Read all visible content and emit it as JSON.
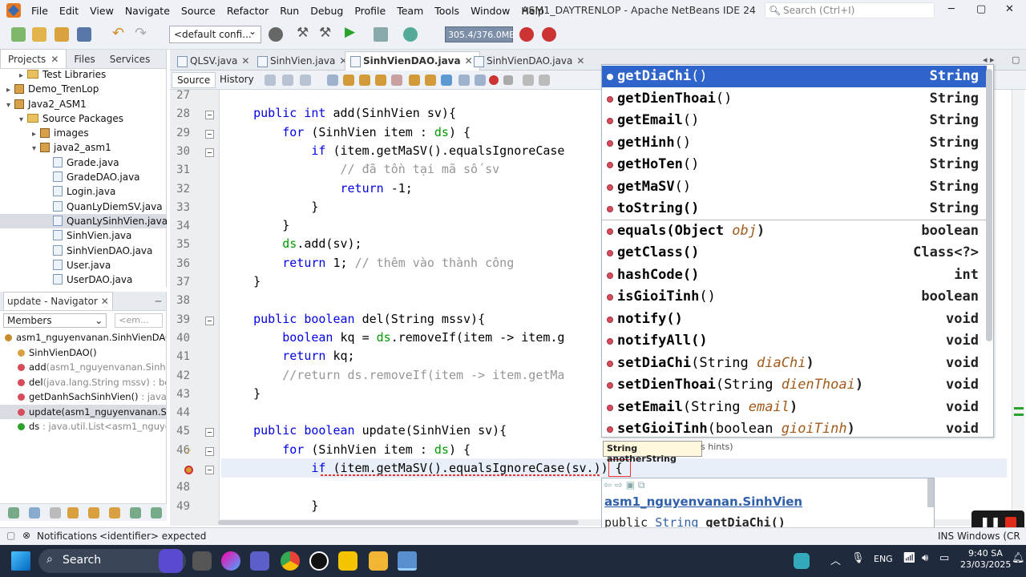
{
  "window": {
    "title": "ASM1_DAYTRENLOP - Apache NetBeans IDE 24",
    "search_placeholder": "Search (Ctrl+I)"
  },
  "menu": [
    "File",
    "Edit",
    "View",
    "Navigate",
    "Source",
    "Refactor",
    "Run",
    "Debug",
    "Profile",
    "Team",
    "Tools",
    "Window",
    "Help"
  ],
  "toolbar": {
    "config": "<default confi...",
    "memory": "305.4/376.0MB"
  },
  "projects_pane": {
    "tabs": [
      "Projects",
      "Files",
      "Services"
    ],
    "items": [
      {
        "label": "Test Libraries",
        "kind": "folder",
        "indent": 1,
        "arrow": "▸"
      },
      {
        "label": "Demo_TrenLop",
        "kind": "project",
        "indent": 0,
        "arrow": "▸"
      },
      {
        "label": "Java2_ASM1",
        "kind": "project",
        "indent": 0,
        "arrow": "▾"
      },
      {
        "label": "Source Packages",
        "kind": "folder",
        "indent": 1,
        "arrow": "▾"
      },
      {
        "label": "images",
        "kind": "package",
        "indent": 2,
        "arrow": "▸"
      },
      {
        "label": "java2_asm1",
        "kind": "package",
        "indent": 2,
        "arrow": "▾"
      },
      {
        "label": "Grade.java",
        "kind": "file",
        "indent": 3,
        "arrow": ""
      },
      {
        "label": "GradeDAO.java",
        "kind": "file",
        "indent": 3,
        "arrow": ""
      },
      {
        "label": "Login.java",
        "kind": "file",
        "indent": 3,
        "arrow": ""
      },
      {
        "label": "QuanLyDiemSV.java",
        "kind": "file",
        "indent": 3,
        "arrow": ""
      },
      {
        "label": "QuanLySinhVien.java",
        "kind": "file",
        "indent": 3,
        "arrow": "",
        "selected": true
      },
      {
        "label": "SinhVien.java",
        "kind": "file",
        "indent": 3,
        "arrow": ""
      },
      {
        "label": "SinhVienDAO.java",
        "kind": "file",
        "indent": 3,
        "arrow": ""
      },
      {
        "label": "User.java",
        "kind": "file",
        "indent": 3,
        "arrow": ""
      },
      {
        "label": "UserDAO.java",
        "kind": "file",
        "indent": 3,
        "arrow": ""
      }
    ]
  },
  "navigator": {
    "title": "update - Navigator",
    "filter": "Members",
    "filter2": "<em...",
    "items": [
      {
        "main": "asm1_nguyenvanan.SinhVienDAO",
        "gray": " :",
        "icon": "class",
        "indent": 0
      },
      {
        "main": "SinhVienDAO()",
        "gray": "",
        "icon": "ctor",
        "indent": 1
      },
      {
        "main": "add",
        "gray": "(asm1_nguyenvanan.SinhVie",
        "icon": "method",
        "indent": 1
      },
      {
        "main": "del",
        "gray": "(java.lang.String mssv) : bool",
        "icon": "method",
        "indent": 1
      },
      {
        "main": "getDanhSachSinhVien()",
        "gray": " : java.uti",
        "icon": "method",
        "indent": 1
      },
      {
        "main": "update(asm1_nguyenvanan.Sinh",
        "gray": "",
        "icon": "method",
        "indent": 1,
        "selected": true
      },
      {
        "main": "ds",
        "gray": " : java.util.List<asm1_nguyenv",
        "icon": "field",
        "indent": 1
      }
    ]
  },
  "editor": {
    "tabs": [
      {
        "label": "QLSV.java"
      },
      {
        "label": "SinhVien.java"
      },
      {
        "label": "SinhVienDAO.java",
        "active": true
      },
      {
        "label": "SinhVienDAO.java"
      }
    ],
    "subtabs": [
      "Source",
      "History"
    ],
    "lines": [
      {
        "n": "27",
        "t": []
      },
      {
        "n": "28",
        "fold": true,
        "t": [
          [
            "    "
          ],
          [
            "public",
            "kw"
          ],
          [
            " "
          ],
          [
            "int",
            "kw"
          ],
          [
            " add(SinhVien sv){"
          ]
        ]
      },
      {
        "n": "29",
        "fold": true,
        "t": [
          [
            "        "
          ],
          [
            "for",
            "kw"
          ],
          [
            " (SinhVien item : "
          ],
          [
            "ds",
            "fld"
          ],
          [
            ") {"
          ]
        ]
      },
      {
        "n": "30",
        "fold": true,
        "t": [
          [
            "            "
          ],
          [
            "if",
            "kw"
          ],
          [
            " (item.getMaSV().equalsIgnoreCase"
          ]
        ]
      },
      {
        "n": "31",
        "t": [
          [
            "                "
          ],
          [
            "// đã tồn tại mã số sv",
            "cm"
          ]
        ]
      },
      {
        "n": "32",
        "t": [
          [
            "                "
          ],
          [
            "return",
            "kw"
          ],
          [
            " -1;"
          ]
        ]
      },
      {
        "n": "33",
        "t": [
          [
            "            }"
          ]
        ]
      },
      {
        "n": "34",
        "t": [
          [
            "        }"
          ]
        ]
      },
      {
        "n": "35",
        "t": [
          [
            "        "
          ],
          [
            "ds",
            "fld"
          ],
          [
            ".add(sv);"
          ]
        ]
      },
      {
        "n": "36",
        "t": [
          [
            "        "
          ],
          [
            "return",
            "kw"
          ],
          [
            " 1; "
          ],
          [
            "// thêm vào thành công",
            "cm"
          ]
        ]
      },
      {
        "n": "37",
        "t": [
          [
            "    }"
          ]
        ]
      },
      {
        "n": "38",
        "t": []
      },
      {
        "n": "39",
        "fold": true,
        "t": [
          [
            "    "
          ],
          [
            "public",
            "kw"
          ],
          [
            " "
          ],
          [
            "boolean",
            "kw"
          ],
          [
            " del(String mssv){"
          ]
        ]
      },
      {
        "n": "40",
        "t": [
          [
            "        "
          ],
          [
            "boolean",
            "kw"
          ],
          [
            " kq = "
          ],
          [
            "ds",
            "fld"
          ],
          [
            ".removeIf(item -> item.g"
          ]
        ]
      },
      {
        "n": "41",
        "t": [
          [
            "        "
          ],
          [
            "return",
            "kw"
          ],
          [
            " kq;"
          ]
        ]
      },
      {
        "n": "42",
        "t": [
          [
            "        "
          ],
          [
            "//return ds.removeIf(item -> item.getMa",
            "cm"
          ]
        ]
      },
      {
        "n": "43",
        "t": [
          [
            "    }"
          ]
        ]
      },
      {
        "n": "44",
        "t": []
      },
      {
        "n": "45",
        "fold": true,
        "t": [
          [
            "    "
          ],
          [
            "public",
            "kw"
          ],
          [
            " "
          ],
          [
            "boolean",
            "kw"
          ],
          [
            " update(SinhVien sv){"
          ]
        ]
      },
      {
        "n": "46",
        "fold": true,
        "bulb": true,
        "t": [
          [
            "        "
          ],
          [
            "for",
            "kw"
          ],
          [
            " (SinhVien item : "
          ],
          [
            "ds",
            "fld"
          ],
          [
            ") {"
          ]
        ]
      },
      {
        "n": "",
        "fold": true,
        "err": true,
        "t": [
          [
            "            "
          ],
          [
            "if",
            "kw"
          ],
          [
            " (item.getMaSV().equalsIgnoreCase(sv.)) {"
          ]
        ]
      },
      {
        "n": "48",
        "t": []
      },
      {
        "n": "49",
        "t": [
          [
            "            }"
          ]
        ]
      }
    ]
  },
  "completion": {
    "items": [
      {
        "name": "getDiaChi",
        "params": "()",
        "ret": "String",
        "bold": true,
        "selected": true
      },
      {
        "name": "getDienThoai",
        "params": "()",
        "ret": "String",
        "bold": true
      },
      {
        "name": "getEmail",
        "params": "()",
        "ret": "String",
        "bold": true
      },
      {
        "name": "getHinh",
        "params": "()",
        "ret": "String",
        "bold": true
      },
      {
        "name": "getHoTen",
        "params": "()",
        "ret": "String",
        "bold": true
      },
      {
        "name": "getMaSV",
        "params": "()",
        "ret": "String",
        "bold": true
      },
      {
        "name": "toString()",
        "params": "",
        "ret": "String",
        "bold": true
      },
      {
        "name": "equals(Object ",
        "params": "",
        "pname": "obj",
        "tail": ")",
        "ret": "boolean",
        "bold": true
      },
      {
        "name": "getClass()",
        "params": "",
        "ret": "Class<?>",
        "bold": true
      },
      {
        "name": "hashCode()",
        "params": "",
        "ret": "int",
        "bold": true
      },
      {
        "name": "isGioiTinh",
        "params": "()",
        "ret": "boolean",
        "bold": true
      },
      {
        "name": "notify()",
        "params": "",
        "ret": "void",
        "bold": true
      },
      {
        "name": "notifyAll()",
        "params": "",
        "ret": "void",
        "bold": true
      },
      {
        "name": "setDiaChi",
        "params": "(String ",
        "pname": "diaChi",
        "tail": ")",
        "ret": "void",
        "bold": true
      },
      {
        "name": "setDienThoai",
        "params": "(String ",
        "pname": "dienThoai",
        "tail": ")",
        "ret": "void",
        "bold": true
      },
      {
        "name": "setEmail",
        "params": "(String ",
        "pname": "email",
        "tail": ")",
        "ret": "void",
        "bold": true
      },
      {
        "name": "setGioiTinh",
        "params": "(boolean ",
        "pname": "gioiTinh",
        "tail": ")",
        "ret": "void",
        "bold": true
      }
    ]
  },
  "hint": {
    "text": "String anotherString",
    "suffix": "s hints)"
  },
  "doc": {
    "class": "asm1_nguyenvanan.SinhVien",
    "sig_pre": "public ",
    "sig_link": "String",
    "sig_post": " getDiaChi()"
  },
  "status": {
    "notifications": "Notifications",
    "message": "<identifier> expected",
    "ins": "INS Windows (CR"
  },
  "taskbar": {
    "search": "Search",
    "lang": "ENG",
    "time": "9:40 SA",
    "date": "23/03/2025"
  },
  "colors": {
    "selection": "#2f65ca",
    "keyword": "#0000e6",
    "field": "#009900",
    "comment": "#969696"
  }
}
